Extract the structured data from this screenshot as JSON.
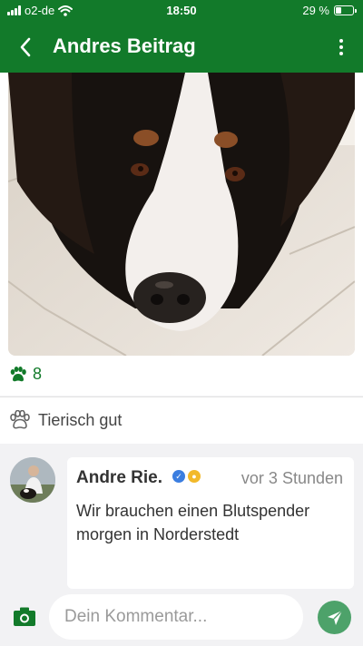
{
  "status_bar": {
    "carrier": "o2-de",
    "time": "18:50",
    "battery_text": "29 %",
    "battery_level": 0.29
  },
  "app_bar": {
    "title": "Andres Beitrag",
    "back_icon": "chevron-left-icon",
    "menu_icon": "more-vertical-icon"
  },
  "post": {
    "paw_count": "8",
    "reaction_label": "Tierisch gut"
  },
  "comment": {
    "author": "Andre Rie.",
    "time": "vor 3 Stunden",
    "text": "Wir brauchen einen Blutspender morgen in Norderstedt"
  },
  "composer": {
    "placeholder": "Dein Kommentar..."
  },
  "colors": {
    "brand_green": "#127a2a",
    "send_green": "#4da26a"
  }
}
